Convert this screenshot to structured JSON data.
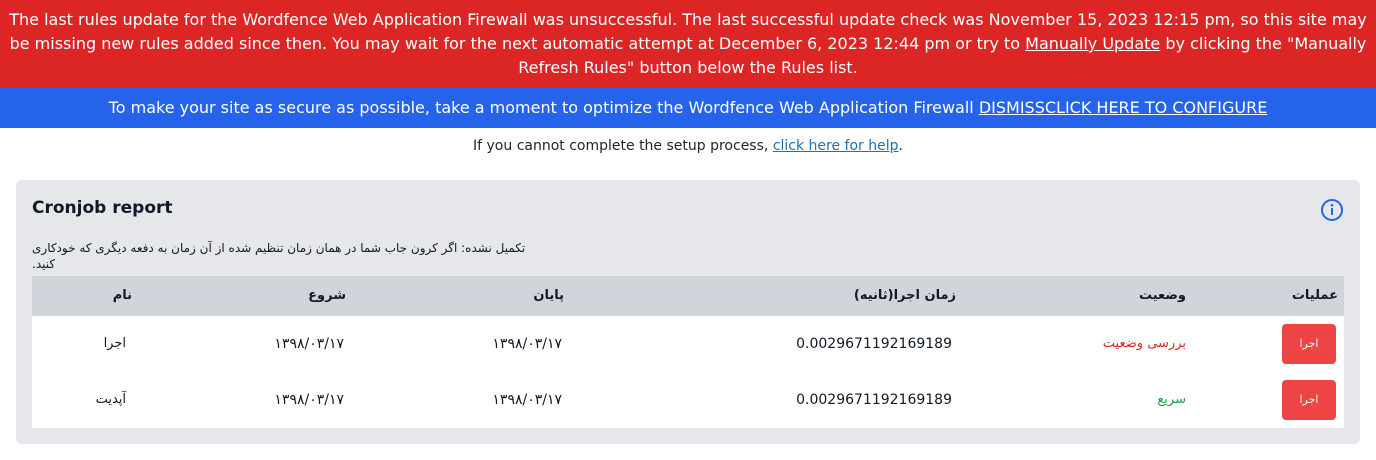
{
  "error_notice": {
    "text_before": "The last rules update for the Wordfence Web Application Firewall was unsuccessful. The last successful update check was November 15, 2023 12:15 pm, so this site may be missing new rules added since then. You may wait for the next automatic attempt at December 6, 2023 12:44 pm or try to ",
    "link_label": "Manually Update",
    "text_after": " by clicking the \"Manually Refresh Rules\" button below the Rules list."
  },
  "info_notice": {
    "text": "To make your site as secure as possible, take a moment to optimize the Wordfence Web Application Firewall ",
    "dismiss_label": "DISMISS",
    "configure_label": "CLICK HERE TO CONFIGURE"
  },
  "setup_help": {
    "text": "If you cannot complete the setup process, ",
    "link_label": "click here for help",
    "suffix": "."
  },
  "card": {
    "title": "Cronjob report",
    "description": "تکمیل نشده: اگر کرون جاب شما در همان زمان تنظیم شده از آن زمان به دفعه دیگری که خودکاری کنید."
  },
  "table": {
    "headers": {
      "name": "نام",
      "start": "شروع",
      "end": "پایان",
      "runtime": "زمان اجرا(ثانیه)",
      "status": "وضعیت",
      "actions": "عملیات"
    },
    "rows": [
      {
        "name": "اجرا",
        "start": "۱۳۹۸/۰۳/۱۷",
        "end": "۱۳۹۸/۰۳/۱۷",
        "runtime": "0.0029671192169189",
        "status": "بررسی وضعیت",
        "status_color": "#dc2626",
        "action_label": "اجرا"
      },
      {
        "name": "آپدیت",
        "start": "۱۳۹۸/۰۳/۱۷",
        "end": "۱۳۹۸/۰۳/۱۷",
        "runtime": "0.0029671192169189",
        "status": "سریع",
        "status_color": "#16a34a",
        "action_label": "اجرا"
      }
    ]
  },
  "colors": {
    "error_bg": "#dc2626",
    "info_bg": "#2563eb",
    "button_bg": "#ef4444"
  }
}
